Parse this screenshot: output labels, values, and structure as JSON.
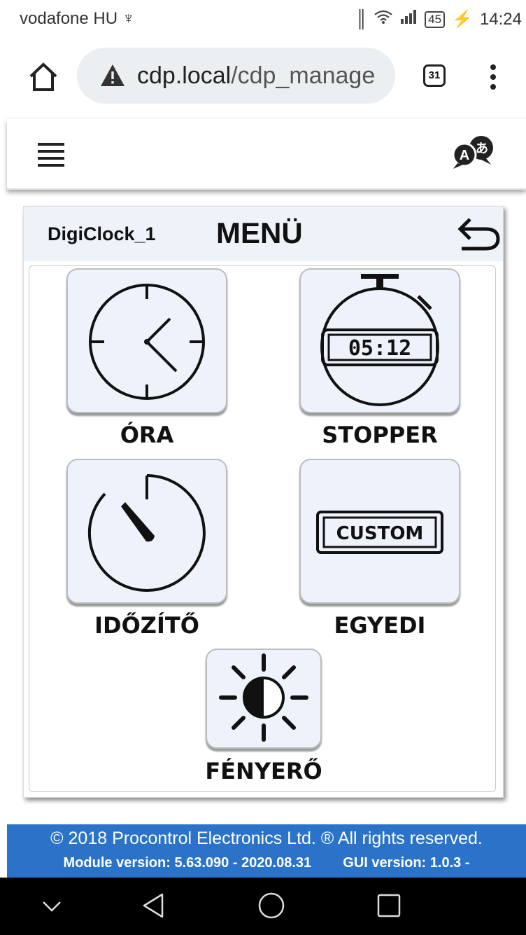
{
  "status_bar": {
    "carrier": "vodafone HU",
    "battery": "45",
    "time": "14:24"
  },
  "browser": {
    "url_host": "cdp.local",
    "url_path": "/cdp_manage",
    "tab_count": "31"
  },
  "panel": {
    "device_name": "DigiClock_1",
    "title": "MENÜ"
  },
  "tiles": [
    {
      "label": "ÓRA",
      "icon": "clock-icon"
    },
    {
      "label": "STOPPER",
      "icon": "stopwatch-icon",
      "display": "05:12"
    },
    {
      "label": "IDŐZÍTŐ",
      "icon": "timer-icon"
    },
    {
      "label": "EGYEDI",
      "icon": "custom-icon",
      "display": "CUSTOM"
    },
    {
      "label": "FÉNYERŐ",
      "icon": "brightness-icon"
    }
  ],
  "footer": {
    "copyright": "© 2018 Procontrol Electronics Ltd. ® All rights reserved.",
    "module_version": "Module version: 5.63.090 - 2020.08.31",
    "gui_version": "GUI version: 1.0.3 -"
  },
  "colors": {
    "footer_bg": "#2b73c8",
    "panel_header_bg": "#eef3fa",
    "tile_bg": "#eef2fb"
  }
}
